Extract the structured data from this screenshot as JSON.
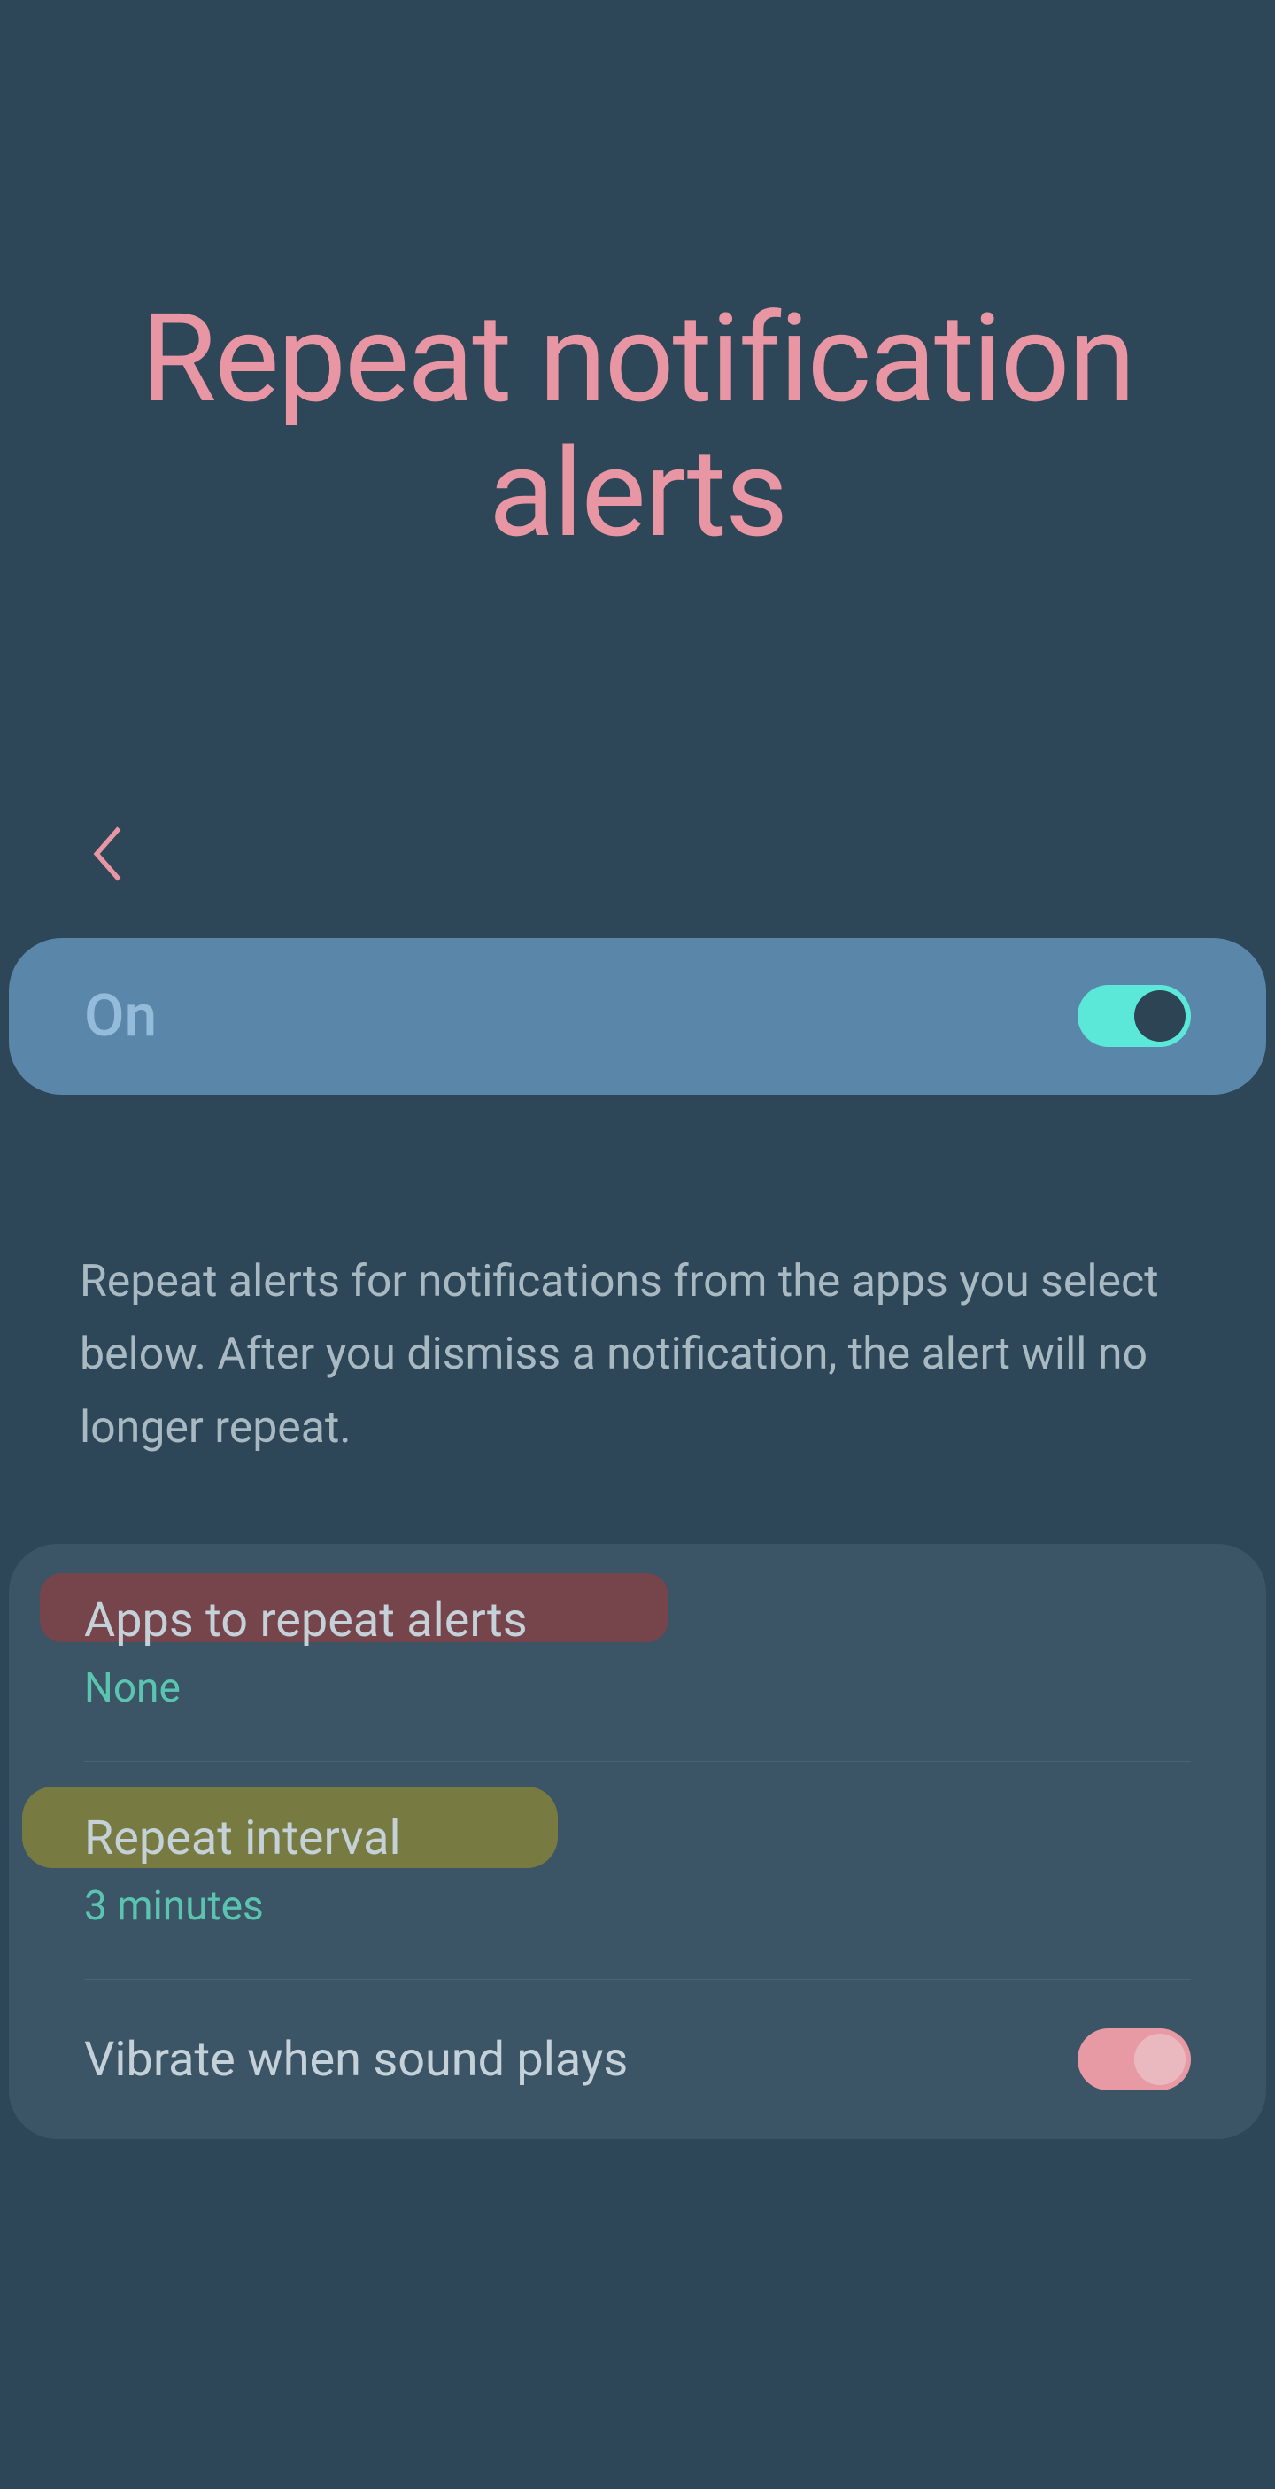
{
  "header": {
    "title": "Repeat notification alerts"
  },
  "masterToggle": {
    "label": "On",
    "state": true
  },
  "description": "Repeat alerts for notifications from the apps you select below. After you dismiss a notification, the alert will no longer repeat.",
  "settings": {
    "appsToRepeat": {
      "label": "Apps to repeat alerts",
      "value": "None"
    },
    "repeatInterval": {
      "label": "Repeat interval",
      "value": "3 minutes"
    },
    "vibrate": {
      "label": "Vibrate when sound plays",
      "state": true
    }
  },
  "colors": {
    "background": "#2d4758",
    "titleColor": "#e896a3",
    "toggleOn": "#5ce8d9",
    "cardBg": "#3b5567",
    "valueAccent": "#5bc4b0"
  }
}
